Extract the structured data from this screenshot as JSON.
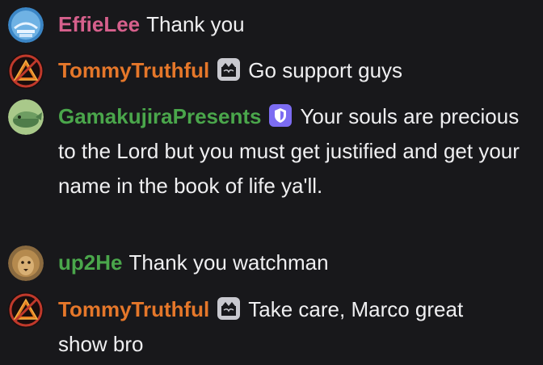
{
  "messages": [
    {
      "username": "EffieLee",
      "username_color": "#d6608c",
      "avatar_icon": "jesus-avatar-icon",
      "badge": null,
      "text": "Thank you"
    },
    {
      "username": "TommyTruthful",
      "username_color": "#e5772a",
      "avatar_icon": "warning-triangle-avatar-icon",
      "badge": "gift-badge-icon",
      "text": "Go support guys"
    },
    {
      "username": "GamakujiraPresents",
      "username_color": "#4aa64b",
      "avatar_icon": "whale-avatar-icon",
      "badge": "moderator-shield-badge-icon",
      "text": "Your souls are precious to the Lord but you must get justified and get your name in the book of life ya'll."
    },
    {
      "username": "up2He",
      "username_color": "#4aa64b",
      "avatar_icon": "lion-avatar-icon",
      "badge": null,
      "text": "Thank you watchman"
    },
    {
      "username": "TommyTruthful",
      "username_color": "#e5772a",
      "avatar_icon": "warning-triangle-avatar-icon",
      "badge": "gift-badge-icon",
      "text": "Take care, Marco great show bro"
    }
  ],
  "colors": {
    "background": "#18181b",
    "message_text": "#efeff1",
    "moderator_badge": "#7c6cf2",
    "gift_badge": "#c9c9cf"
  }
}
